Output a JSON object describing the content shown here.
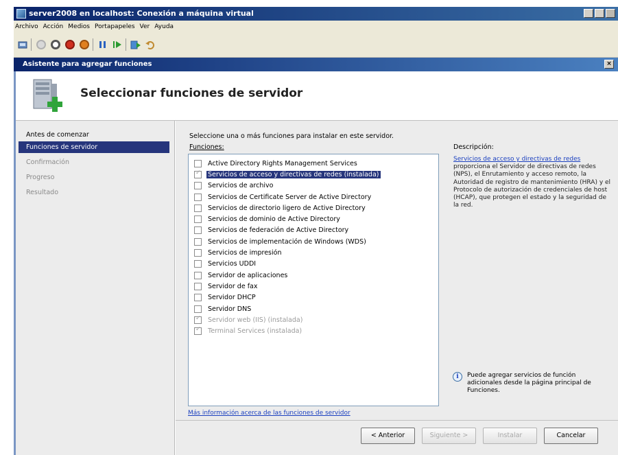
{
  "window": {
    "title": "server2008 en localhost: Conexión a máquina virtual"
  },
  "menubar": [
    "Archivo",
    "Acción",
    "Medios",
    "Portapapeles",
    "Ver",
    "Ayuda"
  ],
  "wizard": {
    "title": "Asistente para agregar funciones",
    "heading": "Seleccionar funciones de servidor"
  },
  "steps": [
    {
      "label": "Antes de comenzar",
      "state": "done"
    },
    {
      "label": "Funciones de servidor",
      "state": "selected"
    },
    {
      "label": "Confirmación",
      "state": "pending"
    },
    {
      "label": "Progreso",
      "state": "pending"
    },
    {
      "label": "Resultado",
      "state": "pending"
    }
  ],
  "main": {
    "instruction": "Seleccione una o más funciones para instalar en este servidor.",
    "roles_label": "Funciones:",
    "description_label": "Descripción:",
    "roles": [
      {
        "label": "Active Directory Rights Management Services",
        "checked": false,
        "disabled": false,
        "selected": false
      },
      {
        "label": "Servicios de acceso y directivas de redes (instalada)",
        "checked": true,
        "disabled": true,
        "selected": true
      },
      {
        "label": "Servicios de archivo",
        "checked": false,
        "disabled": false,
        "selected": false
      },
      {
        "label": "Servicios de Certificate Server de Active Directory",
        "checked": false,
        "disabled": false,
        "selected": false
      },
      {
        "label": "Servicios de directorio ligero de Active Directory",
        "checked": false,
        "disabled": false,
        "selected": false
      },
      {
        "label": "Servicios de dominio de Active Directory",
        "checked": false,
        "disabled": false,
        "selected": false
      },
      {
        "label": "Servicios de federación de Active Directory",
        "checked": false,
        "disabled": false,
        "selected": false
      },
      {
        "label": "Servicios de implementación de Windows (WDS)",
        "checked": false,
        "disabled": false,
        "selected": false
      },
      {
        "label": "Servicios de impresión",
        "checked": false,
        "disabled": false,
        "selected": false
      },
      {
        "label": "Servicios UDDI",
        "checked": false,
        "disabled": false,
        "selected": false
      },
      {
        "label": "Servidor de aplicaciones",
        "checked": false,
        "disabled": false,
        "selected": false
      },
      {
        "label": "Servidor de fax",
        "checked": false,
        "disabled": false,
        "selected": false
      },
      {
        "label": "Servidor DHCP",
        "checked": false,
        "disabled": false,
        "selected": false
      },
      {
        "label": "Servidor DNS",
        "checked": false,
        "disabled": false,
        "selected": false
      },
      {
        "label": "Servidor web (IIS) (instalada)",
        "checked": true,
        "disabled": true,
        "selected": false
      },
      {
        "label": "Terminal Services (instalada)",
        "checked": true,
        "disabled": true,
        "selected": false
      }
    ],
    "description_link": "Servicios de acceso y directivas de redes",
    "description_text": " proporciona el Servidor de directivas de redes (NPS), el Enrutamiento y acceso remoto, la Autoridad de registro de mantenimiento (HRA) y el Protocolo de autorización de credenciales de host (HCAP), que protegen el estado y la seguridad de la red.",
    "info_text": "Puede agregar servicios de función adicionales desde la página principal de Funciones.",
    "more_link": "Más información acerca de las funciones de servidor"
  },
  "buttons": {
    "back": "< Anterior",
    "next": "Siguiente >",
    "install": "Instalar",
    "cancel": "Cancelar"
  },
  "colors": {
    "selection": "#26357c",
    "link": "#1a3fbf",
    "titlebar": "#0a246a"
  }
}
